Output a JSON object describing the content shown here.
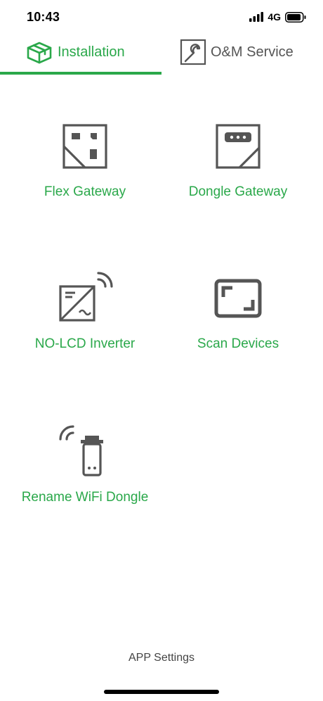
{
  "status_bar": {
    "time": "10:43",
    "network": "4G"
  },
  "tabs": [
    {
      "label": "Installation",
      "icon": "box-icon",
      "active": true
    },
    {
      "label": "O&M Service",
      "icon": "wrench-icon",
      "active": false
    }
  ],
  "menu": {
    "flex_gateway": {
      "label": "Flex Gateway",
      "icon": "flex-gateway-icon"
    },
    "dongle_gateway": {
      "label": "Dongle Gateway",
      "icon": "dongle-gateway-icon"
    },
    "nolcd_inverter": {
      "label": "NO-LCD Inverter",
      "icon": "inverter-wireless-icon"
    },
    "scan_devices": {
      "label": "Scan Devices",
      "icon": "scan-frame-icon"
    },
    "rename_dongle": {
      "label": "Rename WiFi Dongle",
      "icon": "wifi-dongle-icon"
    }
  },
  "footer": {
    "app_settings": "APP Settings"
  },
  "colors": {
    "accent": "#2aa84a",
    "icon": "#555555"
  }
}
